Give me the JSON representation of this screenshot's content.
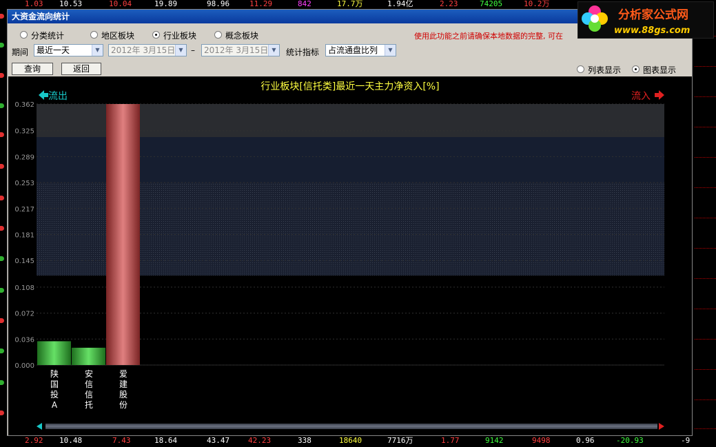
{
  "ticker_top": [
    "1.03",
    "10.53",
    "10.04",
    "19.89",
    "98.96",
    "11.29",
    "842",
    "17.7万",
    "1.94亿",
    "2.23",
    "74205",
    "10.2万"
  ],
  "ticker_bottom": [
    "2.92",
    "10.48",
    "7.43",
    "18.64",
    "43.47",
    "42.23",
    "338",
    "18640",
    "7716万",
    "1.77",
    "9142",
    "9498",
    "0.96",
    "-20.93",
    "-9"
  ],
  "window": {
    "title": "大资金流向统计"
  },
  "tabs": [
    {
      "label": "分类统计",
      "checked": false
    },
    {
      "label": "地区板块",
      "checked": false
    },
    {
      "label": "行业板块",
      "checked": true
    },
    {
      "label": "概念板块",
      "checked": false
    }
  ],
  "warning": "使用此功能之前请确保本地数据的完整, 可在",
  "logo": {
    "name": "分析家公式网",
    "url": "www.88gs.com"
  },
  "period": {
    "label": "期间",
    "value": "最近一天",
    "date_from": "2012年  3月15日",
    "dash": "–",
    "date_to": "2012年  3月15日"
  },
  "indicator": {
    "label": "统计指标",
    "value": "占流通盘比列"
  },
  "buttons": {
    "query": "查询",
    "back": "返回"
  },
  "view": {
    "list": "列表显示",
    "chart": "图表显示",
    "selected": "chart"
  },
  "colors": {
    "inflow": "#e02020",
    "outflow": "#18c8c8",
    "title": "#ffff40",
    "bar_red": "#c0504d",
    "bar_green": "#33bb33"
  },
  "chart_data": {
    "type": "bar",
    "title": "行业板块[信托类]最近一天主力净资入[%]",
    "outflow_label": "流出",
    "inflow_label": "流入",
    "ylim": [
      0,
      0.362
    ],
    "yticks": [
      "0.000",
      "0.036",
      "0.072",
      "0.108",
      "0.145",
      "0.181",
      "0.217",
      "0.253",
      "0.289",
      "0.325",
      "0.362"
    ],
    "categories": [
      "陕国投A",
      "安信信托",
      "爱建股份"
    ],
    "values": [
      0.033,
      0.024,
      0.362
    ],
    "bar_colors": [
      "green",
      "green",
      "red"
    ]
  }
}
